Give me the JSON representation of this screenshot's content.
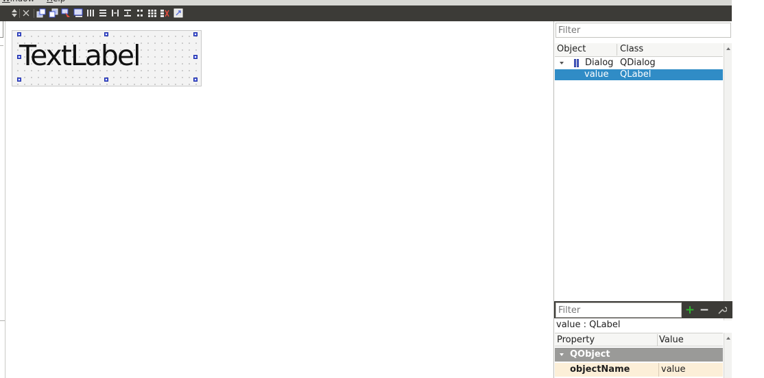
{
  "menubar": {
    "items": [
      {
        "accel": "W",
        "rest": "indow"
      },
      {
        "accel": "H",
        "rest": "elp"
      }
    ]
  },
  "toolbar": {
    "icons": [
      "chevron-updown-icon",
      "close-x-icon",
      "raise-widget-icon",
      "lower-widget-icon",
      "edit-tab-order-icon",
      "edit-buddies-icon",
      "layout-horizontal-icon",
      "layout-vertical-icon",
      "layout-horizontal-splitter-icon",
      "layout-vertical-splitter-icon",
      "layout-form-icon",
      "layout-grid-icon",
      "break-layout-icon",
      "adjust-size-icon"
    ]
  },
  "form": {
    "label_text": "TextLabel"
  },
  "object_inspector": {
    "filter_placeholder": "Filter",
    "columns": {
      "object": "Object",
      "class": "Class"
    },
    "rows": [
      {
        "object": "Dialog",
        "class": "QDialog",
        "selected": false
      },
      {
        "object": "value",
        "class": "QLabel",
        "selected": true
      }
    ]
  },
  "property_editor": {
    "filter_placeholder": "Filter",
    "add_symbol": "+",
    "remove_symbol": "−",
    "selected_caption": "value : QLabel",
    "columns": {
      "property": "Property",
      "value": "Value"
    },
    "group": "QObject",
    "rows": [
      {
        "name": "objectName",
        "value": "value"
      }
    ]
  },
  "colors": {
    "toolbar_bg": "#3c3b37",
    "selection": "#308cc6",
    "group_row": "#9a9a98",
    "property_row": "#fcefd8",
    "add_green": "#2fb52f"
  }
}
